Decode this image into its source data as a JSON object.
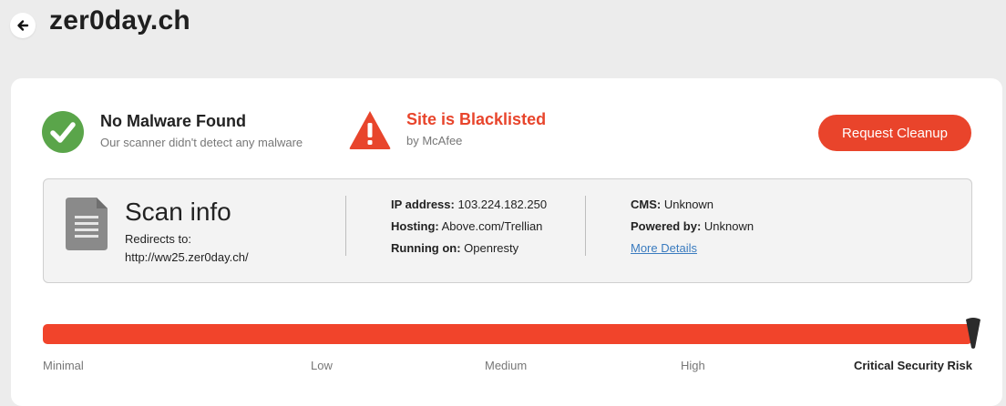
{
  "header": {
    "title": "zer0day.ch",
    "back_icon": "arrow-left-icon"
  },
  "status": {
    "malware": {
      "title": "No Malware Found",
      "subtitle": "Our scanner didn't detect any malware",
      "icon": "check-circle-icon",
      "color": "#5aa54a"
    },
    "blacklist": {
      "title": "Site is Blacklisted",
      "subtitle": "by McAfee",
      "icon": "warning-triangle-icon",
      "color": "#e8452c"
    }
  },
  "actions": {
    "cleanup_label": "Request Cleanup"
  },
  "scan_info": {
    "title": "Scan info",
    "redirect": "Redirects to: http://ww25.zer0day.ch/",
    "ip_label": "IP address:",
    "ip_value": "103.224.182.250",
    "hosting_label": "Hosting:",
    "hosting_value": "Above.com/Trellian",
    "running_label": "Running on:",
    "running_value": "Openresty",
    "cms_label": "CMS:",
    "cms_value": "Unknown",
    "powered_label": "Powered by:",
    "powered_value": "Unknown",
    "more_details": "More Details"
  },
  "risk": {
    "levels": [
      "Minimal",
      "Low",
      "Medium",
      "High",
      "Critical Security Risk"
    ],
    "current": "Critical Security Risk",
    "level_fraction": 1.0,
    "bar_color": "#f1442b"
  }
}
